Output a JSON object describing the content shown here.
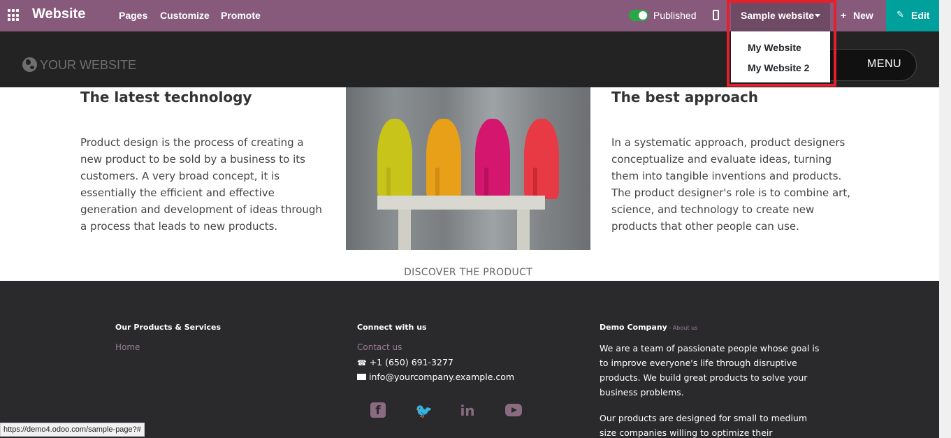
{
  "topbar": {
    "brand": "Website",
    "nav": [
      "Pages",
      "Customize",
      "Promote"
    ],
    "published_label": "Published",
    "website_selector": "Sample website",
    "new_label": "New",
    "edit_label": "Edit",
    "icons": {
      "apps": "apps-grid-icon",
      "mobile": "mobile-preview-icon",
      "caret": "caret-down-icon",
      "new": "plus-icon",
      "edit": "pencil-icon"
    }
  },
  "dropdown": {
    "items": [
      "My Website",
      "My Website 2"
    ]
  },
  "site_header": {
    "logo_text": "YOUR WEBSITE",
    "menu_label": "MENU"
  },
  "content": {
    "left_title": "The latest technology",
    "left_text": "Product design is the process of creating a new product to be sold by a business to its customers. A very broad concept, it is essentially the efficient and effective generation and development of ideas through a process that leads to new products.",
    "right_title": "The best approach",
    "right_text": "In a systematic approach, product designers conceptualize and evaluate ideas, turning them into tangible inventions and products. The product designer's role is to combine art, science, and technology to create new products that other people can use.",
    "discover_label": "DISCOVER THE PRODUCT"
  },
  "footer": {
    "col1_title": "Our Products & Services",
    "col1_link": "Home",
    "col2_title": "Connect with us",
    "col2_link": "Contact us",
    "phone": "+1 (650) 691-3277",
    "email": "info@yourcompany.example.com",
    "col3_title": "Demo Company",
    "col3_sep": " - ",
    "col3_link": "About us",
    "col3_p1": "We are a team of passionate people whose goal is to improve everyone's life through disruptive products. We build great products to solve your business problems.",
    "col3_p2": "Our products are designed for small to medium size companies willing to optimize their performance.",
    "social_icons": [
      "facebook-icon",
      "twitter-icon",
      "linkedin-icon",
      "youtube-icon"
    ]
  },
  "status_bar": {
    "url": "https://demo4.odoo.com/sample-page?#"
  },
  "colors": {
    "topbar": "#875a7b",
    "edit": "#00a09d",
    "highlight": "#e3202c",
    "footer": "#2a2a2d"
  }
}
